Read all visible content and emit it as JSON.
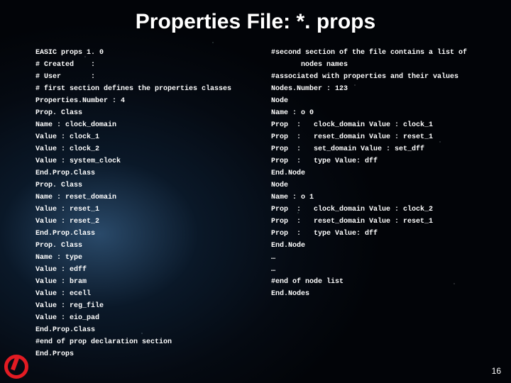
{
  "title": "Properties File: *. props",
  "page_number": "16",
  "left_column": "EASIC props 1. 0\n# Created    :\n# User       :\n# first section defines the properties classes\nProperties.Number : 4\nProp. Class\nName : clock_domain\nValue : clock_1\nValue : clock_2\nValue : system_clock\nEnd.Prop.Class\nProp. Class\nName : reset_domain\nValue : reset_1\nValue : reset_2\nEnd.Prop.Class\nProp. Class\nName : type\nValue : edff\nValue : bram\nValue : ecell\nValue : reg_file\nValue : eio_pad\nEnd.Prop.Class\n#end of prop declaration section\nEnd.Props",
  "right_column": "#second section of the file contains a list of\n       nodes names\n#associated with properties and their values\nNodes.Number : 123\nNode\nName : o 0\nProp  :   clock_domain Value : clock_1\nProp  :   reset_domain Value : reset_1\nProp  :   set_domain Value : set_dff\nProp  :   type Value: dff\nEnd.Node\nNode\nName : o 1\nProp  :   clock_domain Value : clock_2\nProp  :   reset_domain Value : reset_1\nProp  :   type Value: dff\nEnd.Node\n…\n…\n#end of node list\nEnd.Nodes"
}
